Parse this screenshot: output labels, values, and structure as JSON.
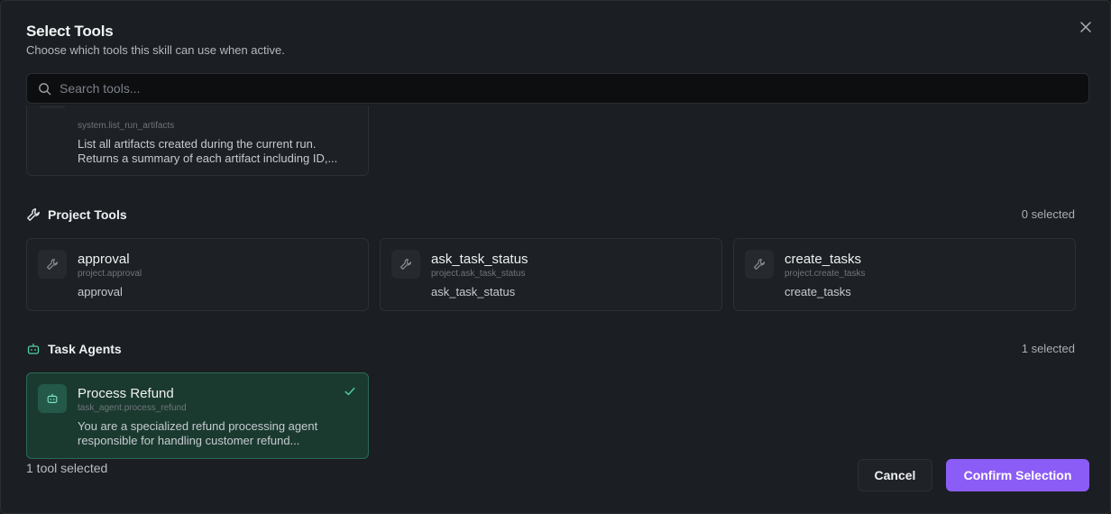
{
  "dialog": {
    "title": "Select Tools",
    "subtitle": "Choose which tools this skill can use when active."
  },
  "search": {
    "placeholder": "Search tools...",
    "value": ""
  },
  "system_tools": {
    "cards": [
      {
        "ident": "system.list_run_artifacts",
        "desc": "List all artifacts created during the current run. Returns a summary of each artifact including ID,..."
      }
    ]
  },
  "project_tools": {
    "label": "Project Tools",
    "count": "0 selected",
    "cards": [
      {
        "name": "approval",
        "ident": "project.approval",
        "desc": "approval",
        "icon": "wrench-icon"
      },
      {
        "name": "ask_task_status",
        "ident": "project.ask_task_status",
        "desc": "ask_task_status",
        "icon": "wrench-icon"
      },
      {
        "name": "create_tasks",
        "ident": "project.create_tasks",
        "desc": "create_tasks",
        "icon": "wrench-icon"
      }
    ]
  },
  "task_agents": {
    "label": "Task Agents",
    "count": "1 selected",
    "cards": [
      {
        "name": "Process Refund",
        "ident": "task_agent.process_refund",
        "desc": "You are a specialized refund processing agent responsible for handling customer refund...",
        "icon": "robot-icon",
        "selected": true
      }
    ]
  },
  "footer": {
    "summary": "1 tool selected",
    "cancel_label": "Cancel",
    "confirm_label": "Confirm Selection"
  },
  "colors": {
    "accent": "#8b5cf6",
    "selected_bg": "#1b3a2f",
    "selected_border": "#2a6a52",
    "check": "#4fd1a5"
  }
}
